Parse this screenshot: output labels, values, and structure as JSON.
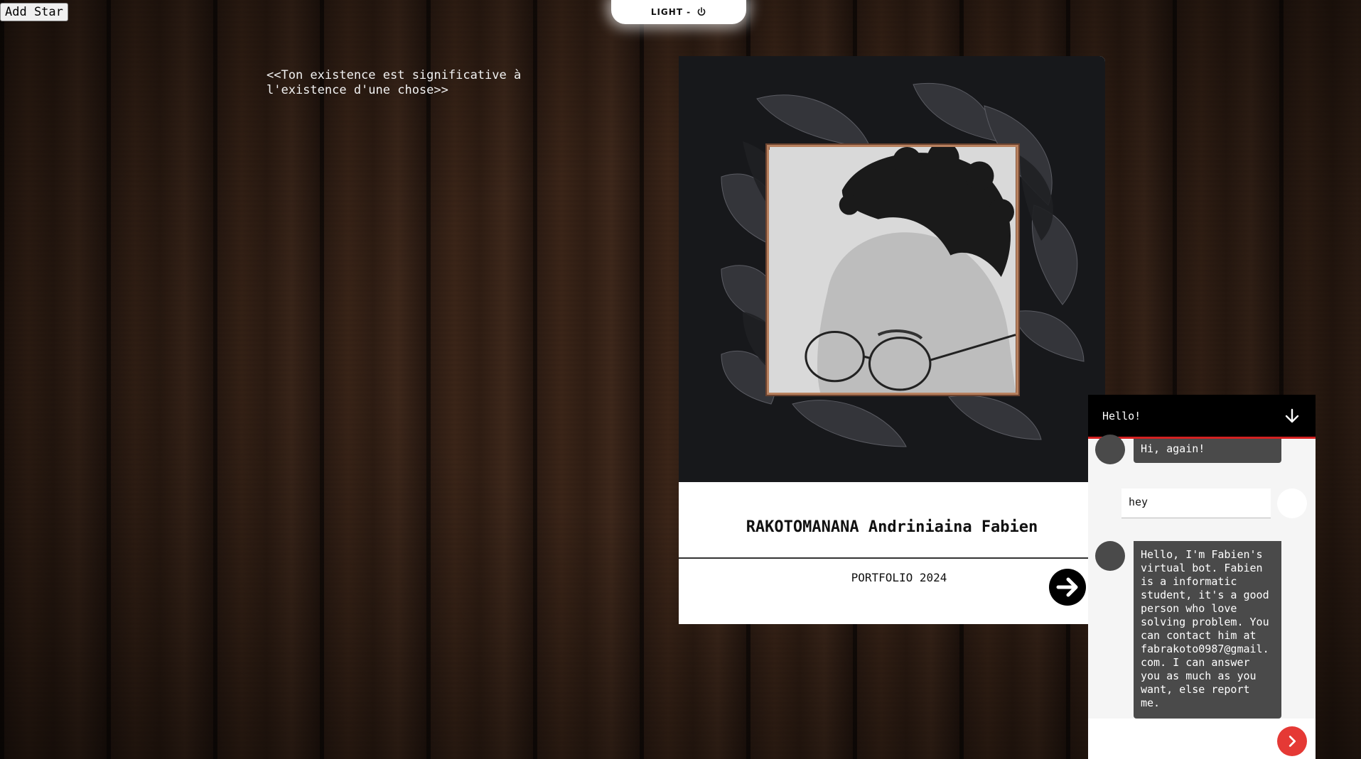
{
  "add_star": {
    "label": "Add Star"
  },
  "theme_toggle": {
    "label": "LIGHT -",
    "icon": "power-icon"
  },
  "quote": {
    "text": "<<Ton existence est significative à l'existence d'une chose>>"
  },
  "card": {
    "name": "RAKOTOMANANA Andriniaina Fabien",
    "subtitle": "PORTFOLIO 2024",
    "next_icon": "arrow-right-circle-icon"
  },
  "chat": {
    "title": "Hello!",
    "collapse_icon": "arrow-down-icon",
    "messages": [
      {
        "from": "bot",
        "text": "Hi, again!"
      },
      {
        "from": "user",
        "text": "hey"
      },
      {
        "from": "bot",
        "text": "Hello, I'm Fabien's virtual bot. Fabien is a informatic student, it's a good person who love solving problem. You can contact him at fabrakoto0987@gmail.com. I can answer you as much as you want, else report me."
      }
    ],
    "send_icon": "chevron-right-icon"
  },
  "colors": {
    "chat_accent": "#d32121",
    "send_button": "#e53935",
    "bot_bubble": "#4a4a4a",
    "card_dark": "#17181b"
  }
}
